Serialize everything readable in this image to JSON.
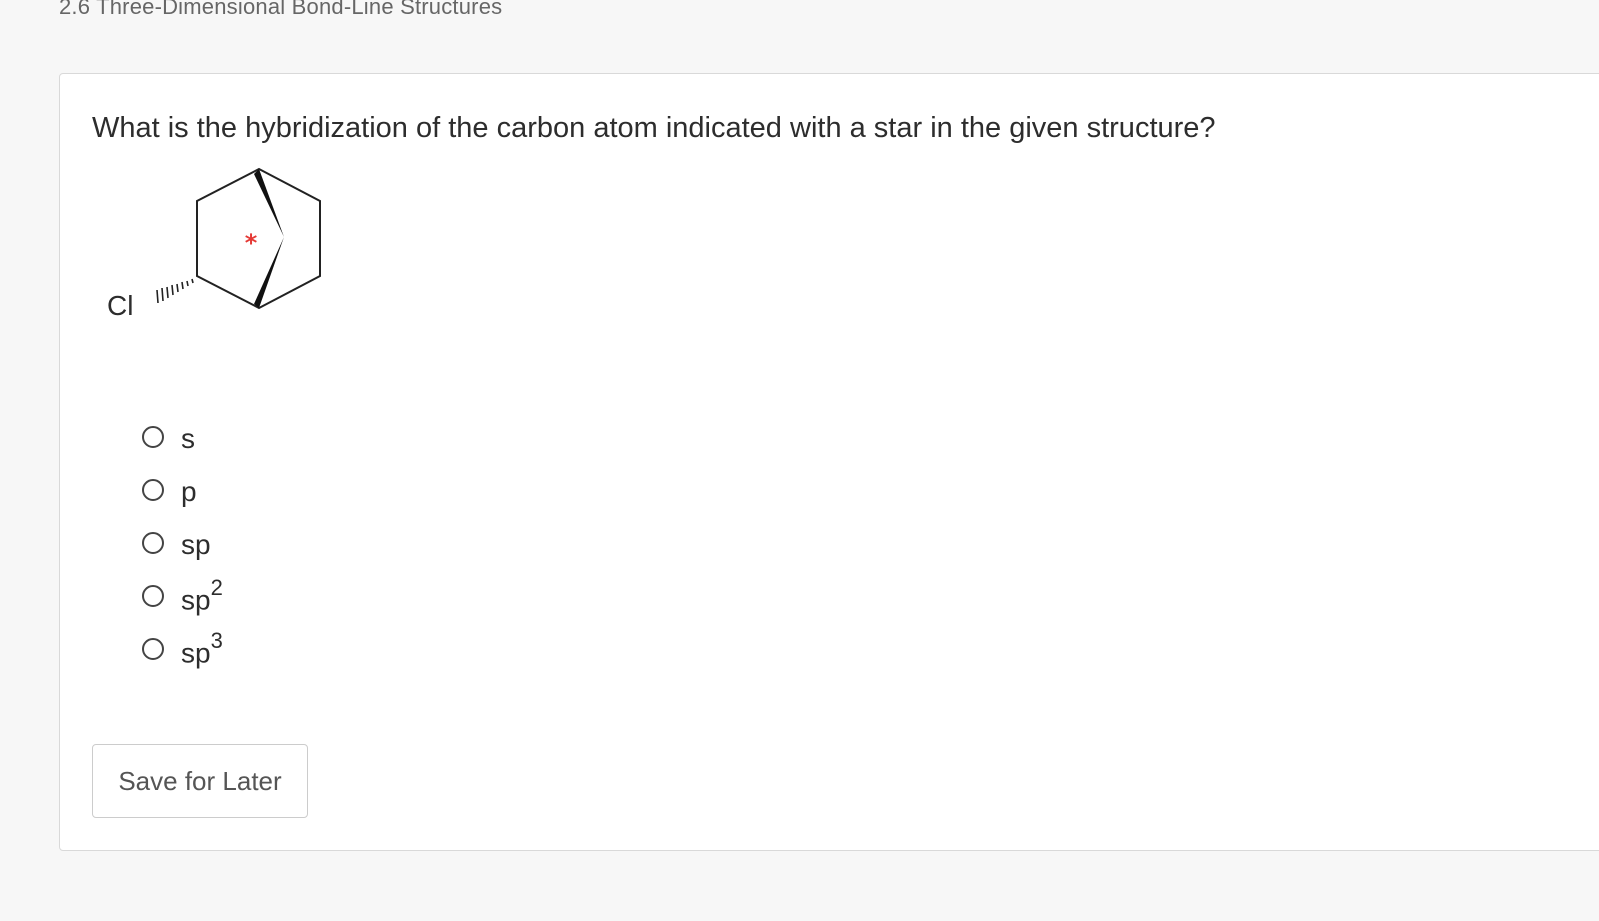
{
  "header": {
    "section_title": "2.6 Three-Dimensional Bond-Line Structures"
  },
  "question": {
    "prompt": "What is the hybridization of the carbon atom indicated with a star in the given structure?",
    "structure": {
      "substituent_label": "Cl",
      "star_marker": "*",
      "star_color": "#e53935"
    },
    "options": [
      {
        "base": "s",
        "sup": ""
      },
      {
        "base": "p",
        "sup": ""
      },
      {
        "base": "sp",
        "sup": ""
      },
      {
        "base": "sp",
        "sup": "2"
      },
      {
        "base": "sp",
        "sup": "3"
      }
    ]
  },
  "actions": {
    "save_label": "Save for Later"
  }
}
